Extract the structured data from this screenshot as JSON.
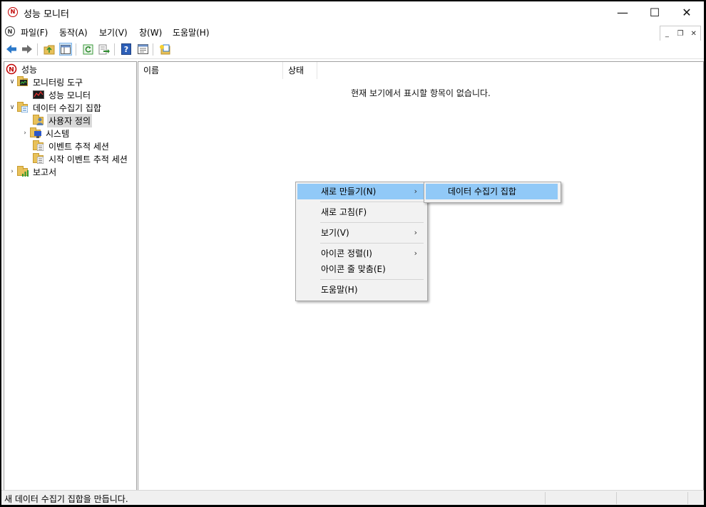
{
  "window": {
    "title": "성능 모니터",
    "minimize_glyph": "—",
    "maximize_glyph": "☐",
    "close_glyph": "✕"
  },
  "menubar": {
    "items": [
      {
        "label": "파일(F)"
      },
      {
        "label": "동작(A)"
      },
      {
        "label": "보기(V)"
      },
      {
        "label": "창(W)"
      },
      {
        "label": "도움말(H)"
      }
    ]
  },
  "toolbar": {
    "icons": [
      "back-icon",
      "forward-icon",
      "up-folder-icon",
      "show-hide-tree-icon",
      "refresh-icon",
      "export-list-icon",
      "help-icon",
      "properties-icon",
      "new-icon"
    ]
  },
  "tree": {
    "items": [
      {
        "label": "성능"
      },
      {
        "label": "모니터링 도구"
      },
      {
        "label": "성능 모니터"
      },
      {
        "label": "데이터 수집기 집합"
      },
      {
        "label": "사용자 정의"
      },
      {
        "label": "시스템"
      },
      {
        "label": "이벤트 추적 세션"
      },
      {
        "label": "시작 이벤트 추적 세션"
      },
      {
        "label": "보고서"
      }
    ]
  },
  "list": {
    "columns": [
      {
        "label": "이름"
      },
      {
        "label": "상태"
      }
    ],
    "empty_message": "현재 보기에서 표시할 항목이 없습니다."
  },
  "context_menu": {
    "items": [
      {
        "label": "새로 만들기(N)"
      },
      {
        "label": "새로 고침(F)"
      },
      {
        "label": "보기(V)"
      },
      {
        "label": "아이콘 정렬(I)"
      },
      {
        "label": "아이콘 줄 맞춤(E)"
      },
      {
        "label": "도움말(H)"
      }
    ],
    "arrow": "›",
    "submenu": {
      "label": "데이터 수집기 집합"
    }
  },
  "statusbar": {
    "text": "새 데이터 수집기 집합을 만듭니다."
  },
  "colors": {
    "highlight": "#91c9f7",
    "selected_tree": "#d9d9d9",
    "app_icon": "#c00000"
  }
}
